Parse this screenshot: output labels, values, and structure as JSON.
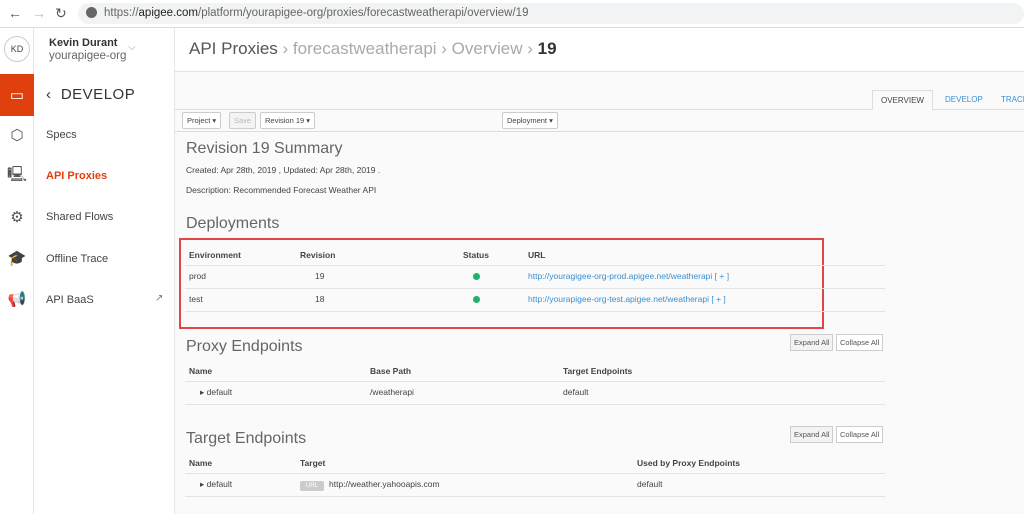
{
  "browser": {
    "url_prefix": "https://",
    "url_domain": "apigee.com",
    "url_path": "/platform/yourapigee-org/proxies/forecastweatherapi/overview/19"
  },
  "user": {
    "initials": "KD",
    "name": "Kevin Durant",
    "org": "yourapigee-org"
  },
  "sidebar": {
    "section": "DEVELOP",
    "items": [
      {
        "label": "Specs"
      },
      {
        "label": "API Proxies",
        "active": true
      },
      {
        "label": "Shared Flows"
      },
      {
        "label": "Offline Trace"
      },
      {
        "label": "API BaaS"
      }
    ]
  },
  "breadcrumb": {
    "root": "API Proxies",
    "proxy": "forecastweatherapi",
    "page": "Overview",
    "revision": "19"
  },
  "tabs": [
    "OVERVIEW",
    "DEVELOP",
    "TRACE"
  ],
  "toolbar": {
    "project": "Project",
    "save": "Save",
    "revision": "Revision 19",
    "deployment": "Deployment"
  },
  "summary": {
    "title": "Revision 19 Summary",
    "dates": "Created: Apr 28th, 2019 , Updated: Apr 28th, 2019 .",
    "description": "Description: Recommended Forecast Weather API"
  },
  "deployments": {
    "title": "Deployments",
    "headers": [
      "Environment",
      "Revision",
      "Status",
      "URL"
    ],
    "rows": [
      {
        "env": "prod",
        "revision": "19",
        "status": "deployed",
        "url": "http://youragigee-org-prod.apigee.net/weatherapi",
        "plus": "[ + ]"
      },
      {
        "env": "test",
        "revision": "18",
        "status": "deployed",
        "url": "http://yourapigee-org-test.apigee.net/weatherapi",
        "plus": "[ + ]"
      }
    ]
  },
  "proxy_endpoints": {
    "title": "Proxy Endpoints",
    "expand": "Expand All",
    "collapse": "Collapse All",
    "headers": [
      "Name",
      "Base Path",
      "Target Endpoints"
    ],
    "rows": [
      {
        "name": "default",
        "base_path": "/weatherapi",
        "targets": "default"
      }
    ]
  },
  "target_endpoints": {
    "title": "Target Endpoints",
    "expand": "Expand All",
    "collapse": "Collapse All",
    "headers": [
      "Name",
      "Target",
      "Used by Proxy Endpoints"
    ],
    "rows": [
      {
        "name": "default",
        "badge": "URL",
        "target": "http://weather.yahooapis.com",
        "used_by": "default"
      }
    ]
  },
  "colors": {
    "accent": "#e0400e",
    "link": "#3a8fd1",
    "status_ok": "#1db36a",
    "highlight": "#e04848"
  }
}
